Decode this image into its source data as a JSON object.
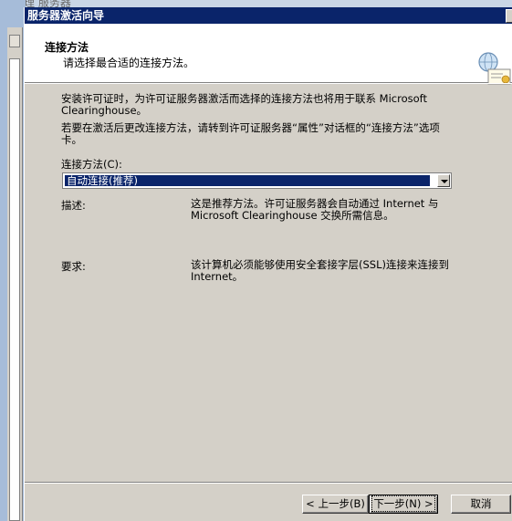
{
  "background": {
    "parent_title": "管理 服务器"
  },
  "window": {
    "title": "服务器激活向导"
  },
  "header": {
    "title": "连接方法",
    "subtitle": "请选择最合适的连接方法。",
    "icon": "certificate-globe-icon"
  },
  "body": {
    "desc1": "安装许可证时，为许可证服务器激活而选择的连接方法也将用于联系 Microsoft Clearinghouse。",
    "desc2": "若要在激活后更改连接方法，请转到许可证服务器“属性”对话框的“连接方法”选项卡。",
    "method_label": "连接方法(C):",
    "method_value": "自动连接(推荐)",
    "description_label": "描述:",
    "description_value": "这是推荐方法。许可证服务器会自动通过 Internet 与 Microsoft Clearinghouse 交换所需信息。",
    "requirement_label": "要求:",
    "requirement_value": "该计算机必须能够使用安全套接字层(SSL)连接来连接到 Internet。"
  },
  "buttons": {
    "back": "< 上一步(B)",
    "next": "下一步(N) >",
    "cancel": "取消"
  },
  "colors": {
    "titlebar": "#0a246a",
    "dialog_bg": "#d4d0c8",
    "selection": "#0a246a"
  }
}
